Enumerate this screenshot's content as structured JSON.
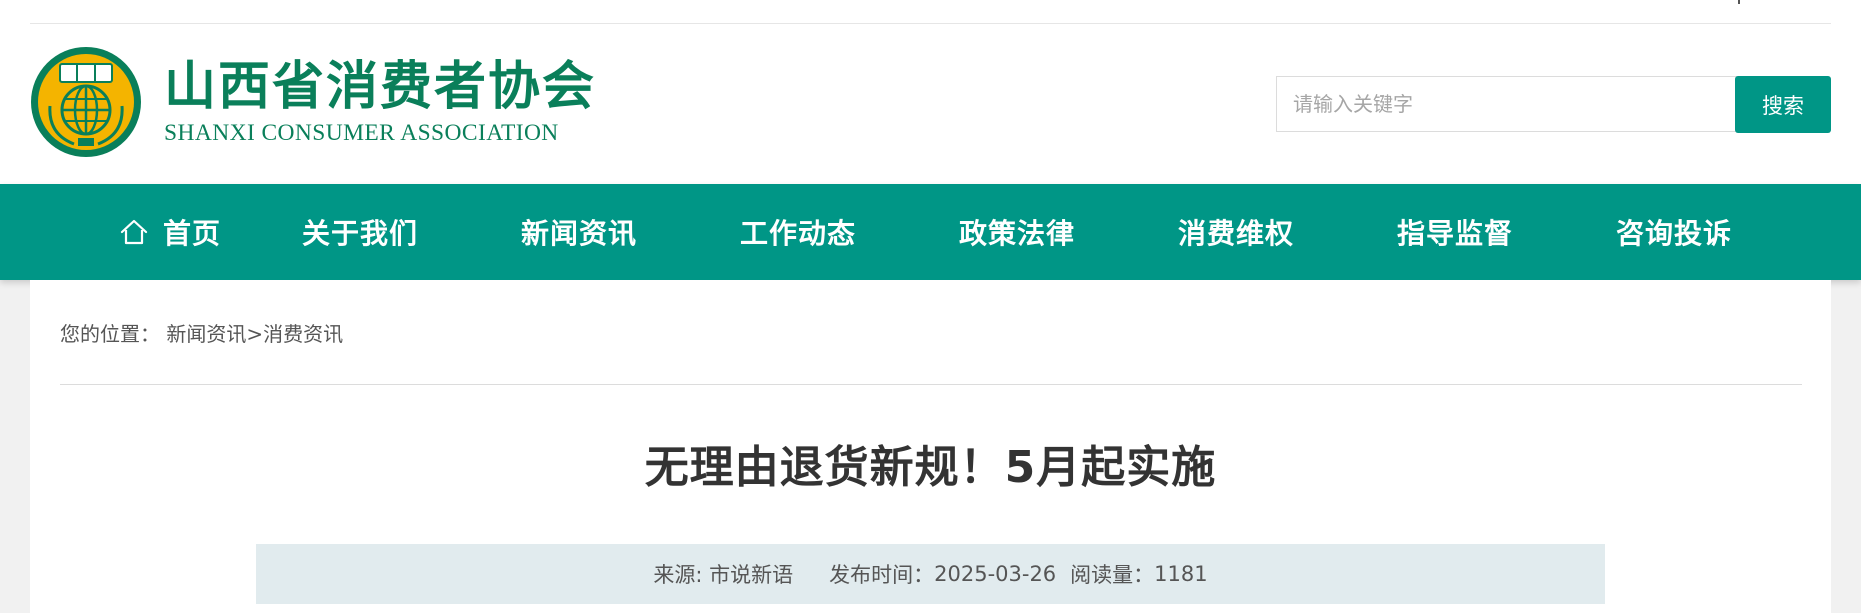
{
  "header": {
    "logo_cn": "山西省消费者协会",
    "logo_en": "SHANXI CONSUMER ASSOCIATION",
    "emblem_icon": "consumer-association-emblem-icon",
    "brand_color": "#0a7f5a"
  },
  "search": {
    "placeholder": "请输入关键字",
    "button_label": "搜索"
  },
  "nav": {
    "color": "#009686",
    "home_icon": "home-icon",
    "items": [
      {
        "label": "首页"
      },
      {
        "label": "关于我们"
      },
      {
        "label": "新闻资讯"
      },
      {
        "label": "工作动态"
      },
      {
        "label": "政策法律"
      },
      {
        "label": "消费维权"
      },
      {
        "label": "指导监督"
      },
      {
        "label": "咨询投诉"
      }
    ]
  },
  "breadcrumb": {
    "prefix": "您的位置：",
    "parent": "新闻资讯",
    "separator": ">",
    "current": "消费资讯"
  },
  "article": {
    "title": "无理由退货新规！5月起实施",
    "source_label": "来源: ",
    "source": "市说新语",
    "date_label": "发布时间：",
    "date": "2025-03-26",
    "views_label": "阅读量：",
    "views": "1181"
  }
}
